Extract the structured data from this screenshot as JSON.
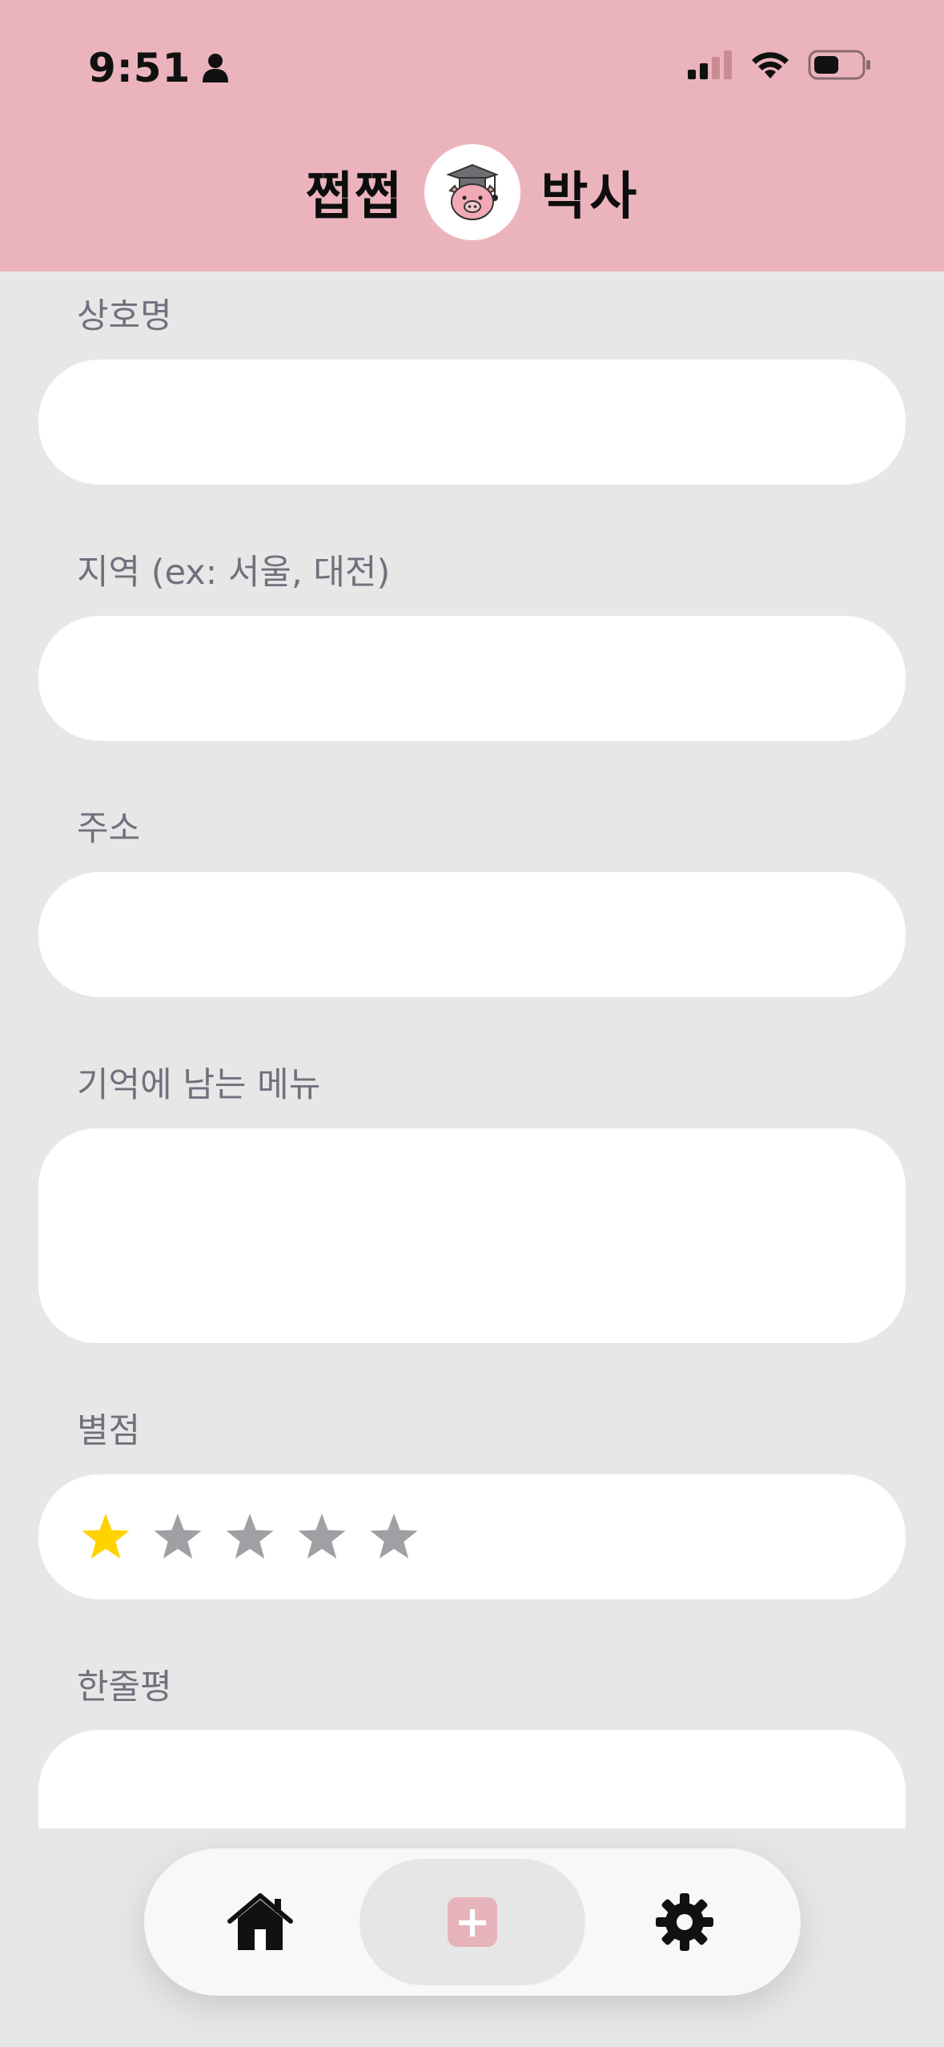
{
  "status_bar": {
    "time": "9:51"
  },
  "header": {
    "brand_left": "쩝쩝",
    "brand_right": "박사"
  },
  "form": {
    "fields": [
      {
        "label": "상호명",
        "value": "",
        "placeholder": ""
      },
      {
        "label": "지역 (ex: 서울, 대전)",
        "value": "",
        "placeholder": ""
      },
      {
        "label": "주소",
        "value": "",
        "placeholder": ""
      },
      {
        "label": "기억에 남는 메뉴",
        "value": "",
        "placeholder": ""
      },
      {
        "label": "별점"
      },
      {
        "label": "한줄평",
        "value": "",
        "placeholder": ""
      }
    ],
    "rating": {
      "value": 1,
      "max": 5,
      "filled_color": "#FFD200",
      "empty_color": "#A0A0A4"
    }
  },
  "tabbar": {
    "tabs": [
      {
        "name": "home",
        "icon": "house-icon"
      },
      {
        "name": "add",
        "icon": "plus-icon",
        "glyph": "+",
        "active": true
      },
      {
        "name": "settings",
        "icon": "gear-icon"
      }
    ]
  },
  "colors": {
    "header_bg": "#EBB4BD",
    "page_bg": "#E7E7E7",
    "label": "#6F717C",
    "accent": "#E6B3BA"
  }
}
